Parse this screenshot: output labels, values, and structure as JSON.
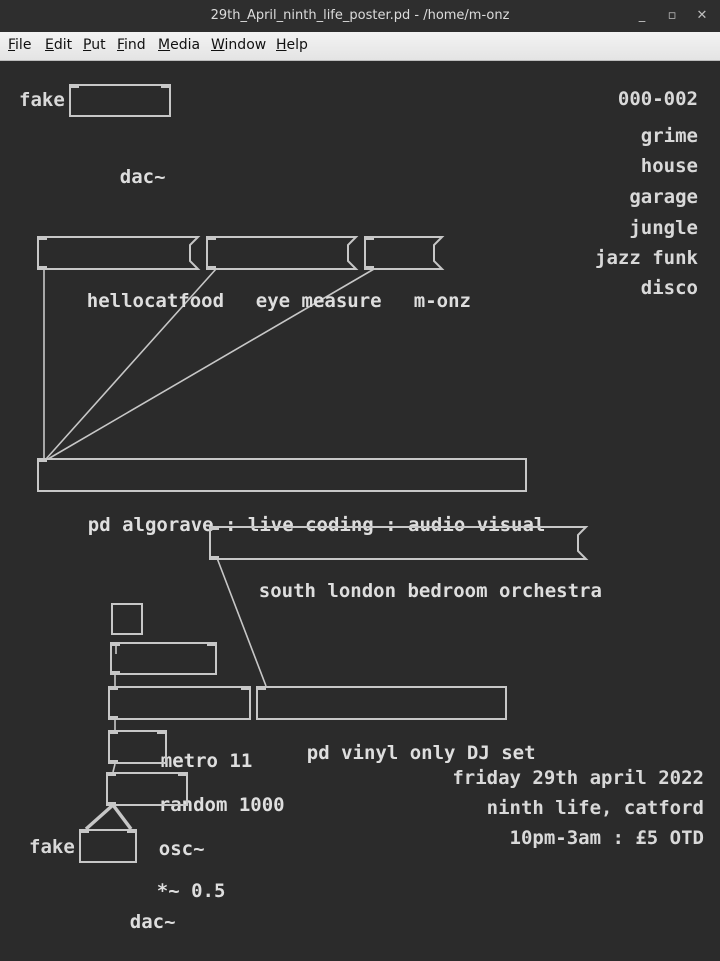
{
  "window": {
    "title": "29th_April_ninth_life_poster.pd  - /home/m-onz",
    "controls": [
      "_",
      "▫",
      "✕"
    ]
  },
  "menu": [
    "File",
    "Edit",
    "Put",
    "Find",
    "Media",
    "Window",
    "Help"
  ],
  "patch": {
    "top_fake": "fake",
    "top_dac": "dac~",
    "catalog": "000-002",
    "genres": [
      "grime",
      "house",
      "garage",
      "jungle",
      "jazz funk",
      "disco"
    ],
    "messages": {
      "hellocatfood": "hellocatfood",
      "eye_measure": "eye measure",
      "m_onz": "m-onz",
      "south_london": "south london bedroom orchestra"
    },
    "objects": {
      "algorave": "pd algorave : live coding : audio visual",
      "metro": "metro 11",
      "random": "random 1000",
      "vinyl": "pd vinyl only DJ set",
      "osc": "osc~",
      "mult": "*~ 0.5",
      "dac": "dac~"
    },
    "bottom_fake": "fake",
    "event": {
      "date": "friday 29th april 2022",
      "venue": "ninth life, catford",
      "time": "10pm-3am : £5 OTD"
    }
  }
}
